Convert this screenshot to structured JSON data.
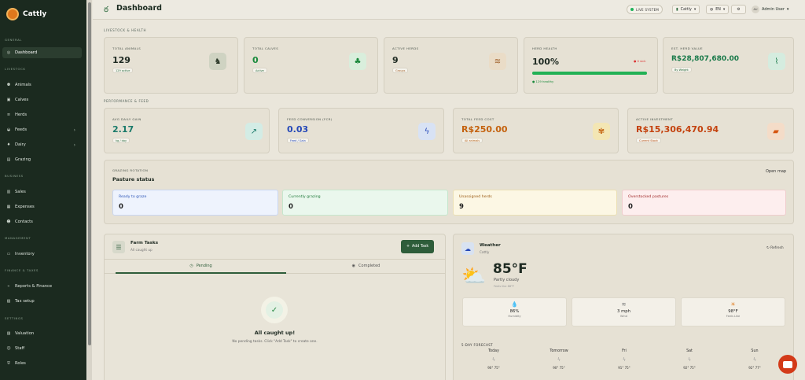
{
  "app": {
    "name": "Cattly"
  },
  "sidebar": {
    "sections": {
      "general": "GENERAL",
      "livestock": "LIVESTOCK",
      "business": "BUSINESS",
      "management": "MANAGEMENT",
      "finance": "FINANCE & TAXES",
      "settings": "SETTINGS"
    },
    "items": {
      "dashboard": "Dashboard",
      "animals": "Animals",
      "calves": "Calves",
      "herds": "Herds",
      "feeds": "Feeds",
      "dairy": "Dairy",
      "grazing": "Grazing",
      "sales": "Sales",
      "expenses": "Expenses",
      "contacts": "Contacts",
      "inventory": "Inventory",
      "reports": "Reports & Finance",
      "tax": "Tax setup",
      "valuation": "Valuation",
      "staff": "Staff",
      "roles": "Roles"
    }
  },
  "header": {
    "title": "Dashboard",
    "live": "LIVE SYSTEM",
    "farm": "Cattly",
    "lang": "EN",
    "avatar": "AU",
    "user": "Admin User"
  },
  "sections": {
    "livestock": "LIVESTOCK & HEALTH",
    "performance": "PERFORMANCE & FEED"
  },
  "kpis": {
    "total_animals": {
      "label": "TOTAL ANIMALS",
      "value": "129",
      "badge": "129 active"
    },
    "total_calves": {
      "label": "TOTAL CALVES",
      "value": "0",
      "badge": "Active"
    },
    "active_herds": {
      "label": "ACTIVE HERDS",
      "value": "9",
      "badge": "Groups"
    },
    "herd_health": {
      "label": "HERD HEALTH",
      "value": "100%",
      "sick": "0 sick",
      "healthy": "129 healthy",
      "percent": 100
    },
    "herd_value": {
      "label": "EST. HERD VALUE",
      "value": "R$28,807,680.00",
      "badge": "By Weight"
    },
    "daily_gain": {
      "label": "AVG DAILY GAIN",
      "value": "2.17",
      "badge": "kg / day"
    },
    "fcr": {
      "label": "FEED CONVERSION (FCR)",
      "value": "0.03",
      "badge": "Feed / Gain"
    },
    "feed_cost": {
      "label": "TOTAL FEED COST",
      "value": "R$250.00",
      "badge": "All animals"
    },
    "investment": {
      "label": "ACTIVE INVESTMENT",
      "value": "R$15,306,470.94",
      "badge": "Current Stock"
    }
  },
  "grazing": {
    "section": "GRAZING ROTATION",
    "title": "Pasture status",
    "link": "Open map",
    "boxes": {
      "ready": {
        "label": "Ready to graze",
        "value": "0"
      },
      "grazing": {
        "label": "Currently grazing",
        "value": "0"
      },
      "unassigned": {
        "label": "Unassigned herds",
        "value": "9"
      },
      "overstocked": {
        "label": "Overstocked pastures",
        "value": "0"
      }
    }
  },
  "tasks": {
    "title": "Farm Tasks",
    "subtitle": "All caught up",
    "add": "Add Task",
    "tab_pending": "Pending",
    "tab_completed": "Completed",
    "empty_title": "All caught up!",
    "empty_text": "No pending tasks. Click \"Add Task\" to create one."
  },
  "weather": {
    "title": "Weather",
    "location": "Cattly",
    "refresh": "Refresh",
    "temp": "85°F",
    "condition": "Partly cloudy",
    "feels": "Feels like 88°F",
    "stats": {
      "humidity": {
        "value": "86%",
        "label": "Humidity"
      },
      "wind": {
        "value": "3 mph",
        "label": "Wind"
      },
      "feels": {
        "value": "98°F",
        "label": "Feels Like"
      }
    },
    "forecast_title": "5-DAY FORECAST",
    "forecast": [
      {
        "day": "Today",
        "temps": "90° 75°"
      },
      {
        "day": "Tomorrow",
        "temps": "90° 75°"
      },
      {
        "day": "Fri",
        "temps": "91° 75°"
      },
      {
        "day": "Sat",
        "temps": "92° 75°"
      },
      {
        "day": "Sun",
        "temps": "92° 77°"
      }
    ]
  }
}
